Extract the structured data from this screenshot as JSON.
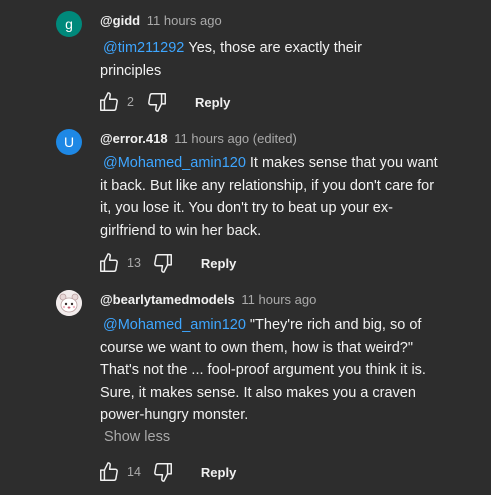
{
  "comments": [
    {
      "avatar_letter": "g",
      "avatar_color": "#00897b",
      "author": "@gidd",
      "time": "11 hours ago",
      "mention": "@tim211292",
      "text": "Yes, those are exactly their principles",
      "likes": "2",
      "reply_label": "Reply"
    },
    {
      "avatar_letter": "U",
      "avatar_color": "#1e88e5",
      "author": "@error.418",
      "time": "11 hours ago (edited)",
      "mention": "@Mohamed_amin120",
      "text": "It makes sense that you want it back. But like any relationship, if you don't care for it, you lose it. You don't try to beat up your ex-girlfriend to win her back.",
      "likes": "13",
      "reply_label": "Reply"
    },
    {
      "avatar_letter": "",
      "avatar_color": "#f2ecec",
      "author": "@bearlytamedmodels",
      "time": "11 hours ago",
      "mention": "@Mohamed_amin120",
      "text": "\"They're rich and big, so of course we want to own them, how is that weird?\" That's not the ... fool-proof argument you think it is. Sure, it makes sense. It also makes you a craven power-hungry monster.",
      "show_less": "Show less",
      "likes": "14",
      "reply_label": "Reply"
    }
  ],
  "icons": {
    "like": "thumbs-up-icon",
    "dislike": "thumbs-down-icon"
  }
}
